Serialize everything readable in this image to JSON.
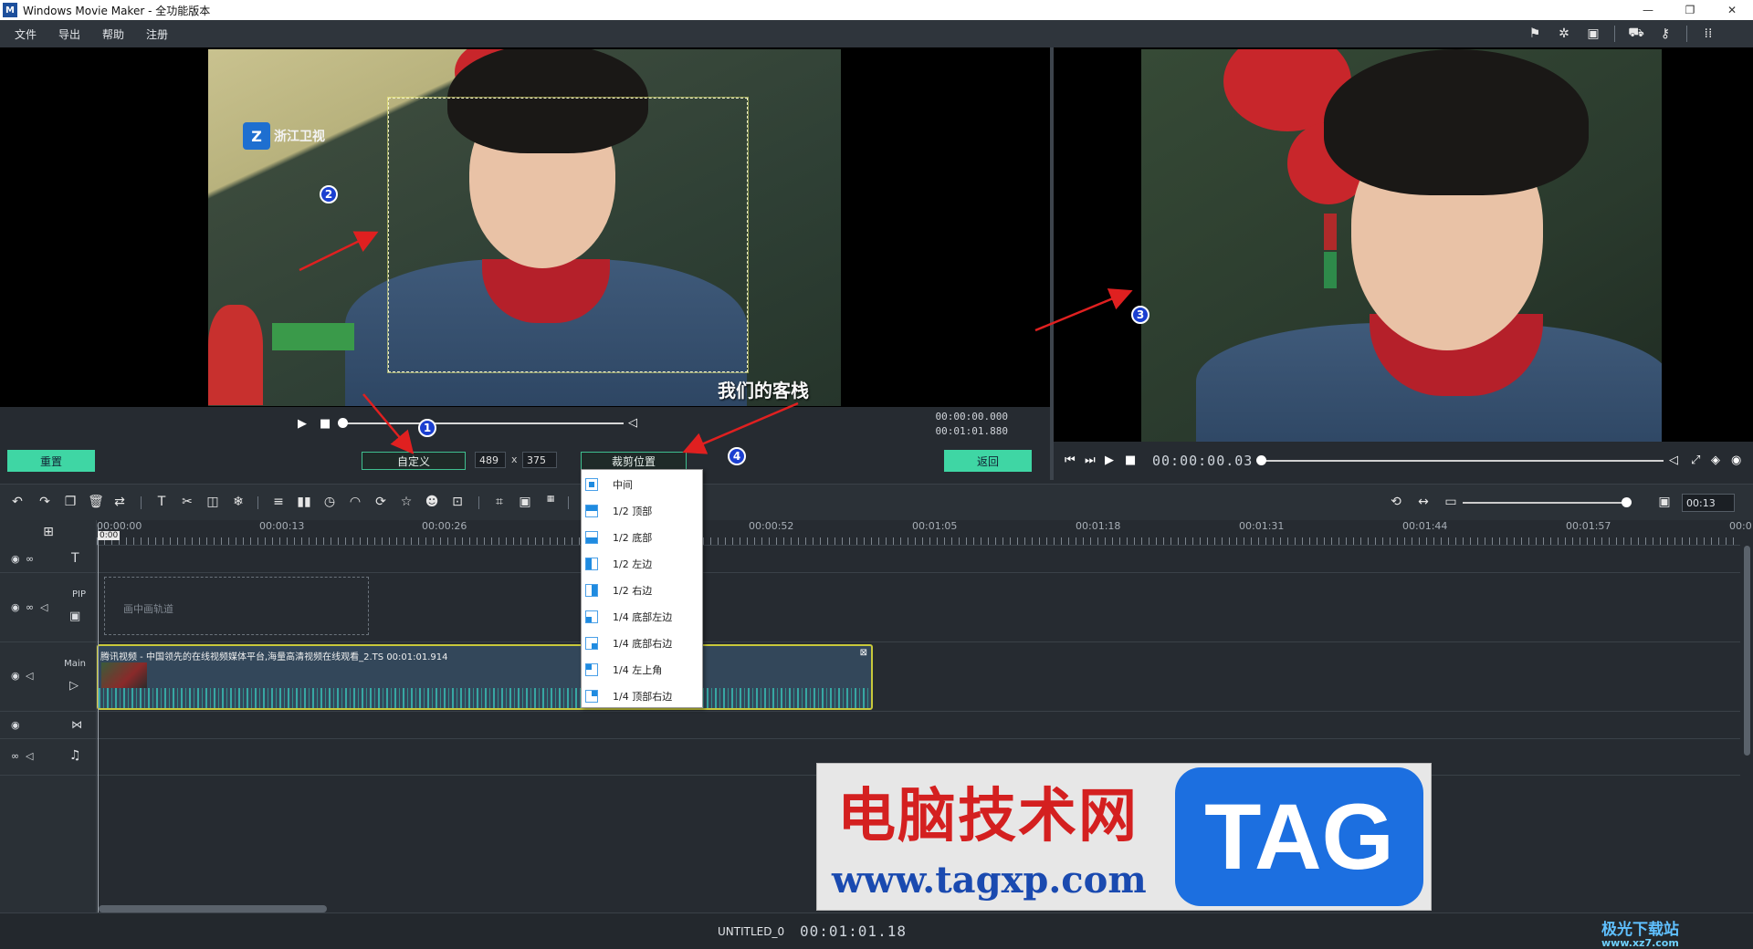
{
  "window": {
    "title": "Windows Movie Maker - 全功能版本",
    "logo_letter": "M",
    "controls": [
      "—",
      "❐",
      "✕"
    ]
  },
  "menu": [
    "文件",
    "导出",
    "帮助",
    "注册"
  ],
  "top_icons": [
    "flag-icon",
    "magic-icon",
    "save-icon",
    "cart-icon",
    "key-icon",
    "layout-icon"
  ],
  "left_preview": {
    "channel_logo": "浙江卫视",
    "show_logo": "我们的客栈",
    "time_current": "00:00:00.000",
    "time_total": "00:01:01.880"
  },
  "crop_bar": {
    "reset_label": "重置",
    "custom_label": "自定义",
    "width_value": "489",
    "times_sign": "x",
    "height_value": "375",
    "crop_position_label": "裁剪位置",
    "back_label": "返回"
  },
  "right_transport": {
    "timecode": "00:00:00.03"
  },
  "annotations": [
    "1",
    "2",
    "3",
    "4"
  ],
  "crop_dropdown": {
    "options": [
      "中间",
      "1/2 顶部",
      "1/2 底部",
      "1/2 左边",
      "1/2 右边",
      "1/4 底部左边",
      "1/4 底部右边",
      "1/4 左上角",
      "1/4 顶部右边"
    ]
  },
  "toolbar": {
    "zoom_value": "00:13"
  },
  "timeline": {
    "ruler_labels": [
      "00:00:00",
      "00:00:13",
      "00:00:26",
      "00:00:52",
      "00:01:05",
      "00:01:18",
      "00:01:31",
      "00:01:44",
      "00:01:57",
      "00:0"
    ],
    "playhead_label": "0:00",
    "tracks": {
      "pip_label": "PIP",
      "main_label": "Main",
      "pip_placeholder": "画中画轨道"
    },
    "main_clip": {
      "title": "腾讯视频 - 中国领先的在线视频媒体平台,海量高清视频在线观看_2.TS   00:01:01.914"
    }
  },
  "status": {
    "project_name": "UNTITLED_0",
    "time": "00:01:01.18"
  },
  "watermark": {
    "site_cn": "电脑技术网",
    "site_url": "www.tagxp.com",
    "tag": "TAG",
    "corner_text": "极光下载站",
    "corner_sub": "www.xz7.com"
  }
}
